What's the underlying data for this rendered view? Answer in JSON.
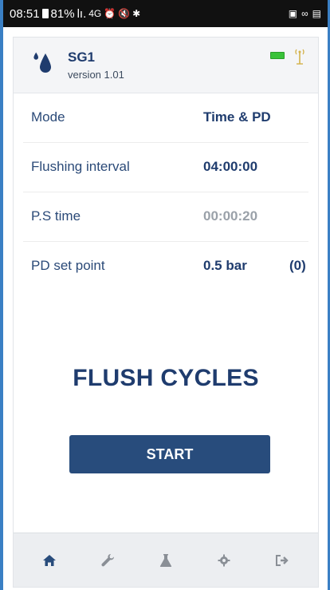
{
  "status_bar": {
    "time": "08:51",
    "battery": "81%",
    "signal": "lı.",
    "network": "4G"
  },
  "header": {
    "device_name": "SG1",
    "version": "version 1.01",
    "icons": [
      "water-drop-icon",
      "battery-icon",
      "antenna-icon"
    ]
  },
  "settings": [
    {
      "label": "Mode",
      "value": "Time & PD",
      "extra": ""
    },
    {
      "label": "Flushing interval",
      "value": "04:00:00",
      "extra": ""
    },
    {
      "label": "P.S time",
      "value": "00:00:20",
      "extra": ""
    },
    {
      "label": "PD set point",
      "value": "0.5 bar",
      "extra": "(0)"
    }
  ],
  "main": {
    "title": "FLUSH CYCLES",
    "start_label": "START"
  },
  "tabbar": {
    "tabs": [
      "home-icon",
      "wrench-icon",
      "flask-icon",
      "gear-icon",
      "logout-icon"
    ]
  },
  "colors": {
    "primary": "#1f3c6e",
    "button": "#284c7c",
    "muted": "#9aa1a9",
    "battery_green": "#39c239"
  }
}
